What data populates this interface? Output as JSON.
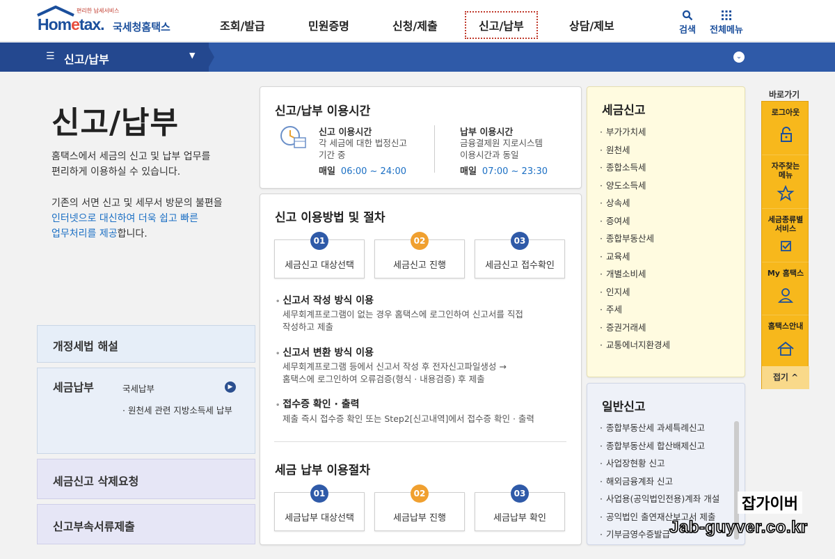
{
  "header": {
    "logo_small": "편리한 납세서비스",
    "logo_main_1": "Hom",
    "logo_main_e": "e",
    "logo_main_2": "tax.",
    "logo_sub": "국세청홈택스",
    "nav": [
      "조회/발급",
      "민원증명",
      "신청/제출",
      "신고/납부",
      "상담/제보"
    ],
    "active_nav_index": 3,
    "search_label": "검색",
    "allmenu_label": "전체메뉴"
  },
  "breadcrumb": {
    "title": "신고/납부"
  },
  "left": {
    "page_title": "신고/납부",
    "desc1": [
      "홈택스에서 세금의 신고 및 납부 업무를",
      "편리하게 이용하실 수 있습니다."
    ],
    "desc2_a": "기존의 서면 신고 및 세무서 방문의 불편을",
    "desc2_b": "인터넷으로 대신하여 더욱 쉽고 빠른",
    "desc2_c_hl": "업무처리를 제공",
    "desc2_c_rest": "합니다.",
    "box1": "개정세법 해설",
    "box2": "세금납부",
    "box2_links": [
      "국세납부",
      "원천세 관련 지방소득세 납부"
    ],
    "box3": "세금신고 삭제요청",
    "box4": "신고부속서류제출"
  },
  "usage_time": {
    "title": "신고/납부 이용시간",
    "report": {
      "head": "신고 이용시간",
      "desc": [
        "각 세금에 대한 법정신고",
        "기간 중"
      ],
      "daily": "매일",
      "time": "06:00 ~ 24:00"
    },
    "pay": {
      "head": "납부 이용시간",
      "desc": [
        "금융결제원 지로시스템",
        "이용시간과 동일"
      ],
      "daily": "매일",
      "time": "07:00 ~ 23:30"
    }
  },
  "procedure": {
    "title": "신고 이용방법 및 절차",
    "steps": [
      {
        "num": "01",
        "label": "세금신고 대상선택"
      },
      {
        "num": "02",
        "label": "세금신고 진행"
      },
      {
        "num": "03",
        "label": "세금신고 접수확인"
      }
    ],
    "methods": [
      {
        "head": "신고서 작성 방식 이용",
        "desc": [
          "세무회계프로그램이 없는 경우 홈택스에 로그인하여 신고서를 직접",
          "작성하고 제출"
        ]
      },
      {
        "head": "신고서 변환 방식 이용",
        "desc": [
          "세무회계프로그램 등에서 신고서 작성 후 전자신고파일생성 →",
          "홈택스에 로그인하여 오류검증(형식 · 내용검증) 후 제출"
        ]
      },
      {
        "head": "접수증 확인 · 출력",
        "desc": [
          "제출 즉시 접수증 확인 또는 Step2[신고내역]에서 접수증 확인 · 출력"
        ]
      }
    ],
    "pay_title": "세금 납부 이용절차",
    "pay_steps": [
      {
        "num": "01",
        "label": "세금납부 대상선택"
      },
      {
        "num": "02",
        "label": "세금납부 진행"
      },
      {
        "num": "03",
        "label": "세금납부 확인"
      }
    ]
  },
  "tax_report": {
    "title": "세금신고",
    "items": [
      "부가가치세",
      "원천세",
      "종합소득세",
      "양도소득세",
      "상속세",
      "증여세",
      "종합부동산세",
      "교육세",
      "개별소비세",
      "인지세",
      "주세",
      "증권거래세",
      "교통에너지환경세"
    ]
  },
  "general_report": {
    "title": "일반신고",
    "items": [
      "종합부동산세 과세특례신고",
      "종합부동산세 합산배제신고",
      "사업장현황 신고",
      "해외금융계좌 신고",
      "사업용(공익법인전용)계좌 개설",
      "공익법인 출연재산보고서 제출",
      "기부금영수증발급"
    ]
  },
  "quick_menu": {
    "title": "바로가기",
    "items": [
      {
        "label": [
          "로그아웃"
        ],
        "icon": "unlock-icon"
      },
      {
        "label": [
          "자주찾는",
          "메뉴"
        ],
        "icon": "star-icon"
      },
      {
        "label": [
          "세금종류별",
          "서비스"
        ],
        "icon": "checkbox-icon"
      },
      {
        "label": [
          "My 홈택스"
        ],
        "icon": "person-icon"
      },
      {
        "label": [
          "홈택스안내"
        ],
        "icon": "home-icon"
      }
    ],
    "close": "접기 ^"
  },
  "watermark": {
    "line1": "잡가이버",
    "line2": "Jab-guyver.co.kr"
  }
}
